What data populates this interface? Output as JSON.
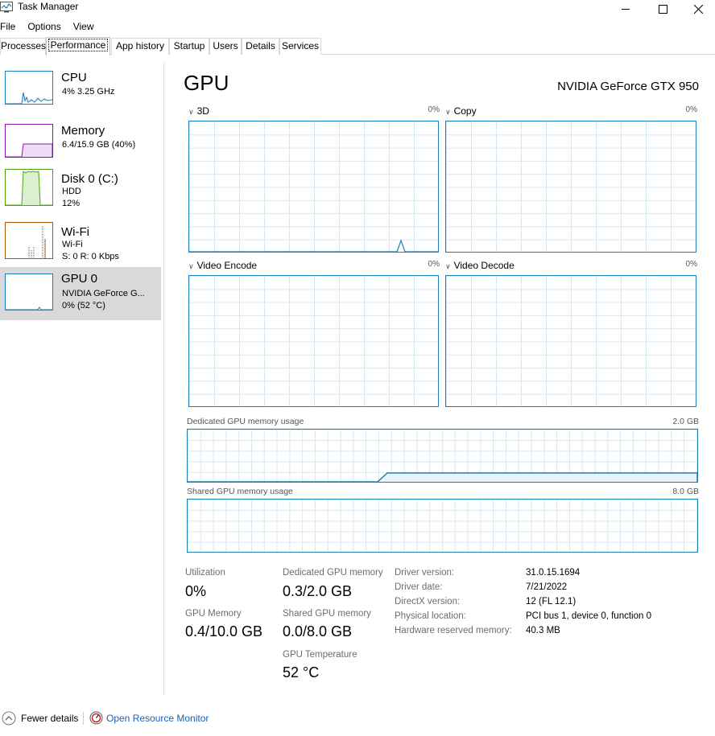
{
  "window": {
    "title": "Task Manager"
  },
  "menu": [
    "File",
    "Options",
    "View"
  ],
  "tabs": [
    "Processes",
    "Performance",
    "App history",
    "Startup",
    "Users",
    "Details",
    "Services"
  ],
  "sidebar": [
    {
      "title": "CPU",
      "line1": "4% 3.25 GHz",
      "line2": "",
      "color": "#1e7eb8"
    },
    {
      "title": "Memory",
      "line1": "6.4/15.9 GB (40%)",
      "line2": "",
      "color": "#8b12ae"
    },
    {
      "title": "Disk 0 (C:)",
      "line1": "HDD",
      "line2": "12%",
      "color": "#4da60c"
    },
    {
      "title": "Wi-Fi",
      "line1": "Wi-Fi",
      "line2": "S: 0 R: 0 Kbps",
      "color": "#a74f01"
    },
    {
      "title": "GPU 0",
      "line1": "NVIDIA GeForce G...",
      "line2": "0% (52 °C)",
      "color": "#1e7eb8"
    }
  ],
  "gpu": {
    "title": "GPU",
    "model": "NVIDIA GeForce GTX 950",
    "engines": [
      {
        "name": "3D",
        "pct": "0%"
      },
      {
        "name": "Copy",
        "pct": "0%"
      },
      {
        "name": "Video Encode",
        "pct": "0%"
      },
      {
        "name": "Video Decode",
        "pct": "0%"
      }
    ],
    "dedicated_label": "Dedicated GPU memory usage",
    "dedicated_max": "2.0 GB",
    "shared_label": "Shared GPU memory usage",
    "shared_max": "8.0 GB",
    "stats": {
      "utilization_label": "Utilization",
      "utilization": "0%",
      "gpu_memory_label": "GPU Memory",
      "gpu_memory": "0.4/10.0 GB",
      "dedicated_label": "Dedicated GPU memory",
      "dedicated": "0.3/2.0 GB",
      "shared_label": "Shared GPU memory",
      "shared": "0.0/8.0 GB",
      "temp_label": "GPU Temperature",
      "temp": "52 °C"
    },
    "info": [
      {
        "key": "Driver version:",
        "value": "31.0.15.1694"
      },
      {
        "key": "Driver date:",
        "value": "7/21/2022"
      },
      {
        "key": "DirectX version:",
        "value": "12 (FL 12.1)"
      },
      {
        "key": "Physical location:",
        "value": "PCI bus 1, device 0, function 0"
      },
      {
        "key": "Hardware reserved memory:",
        "value": "40.3 MB"
      }
    ]
  },
  "footer": {
    "fewer": "Fewer details",
    "orm": "Open Resource Monitor"
  },
  "colors": {
    "graph_line": "#1e7eb8",
    "grid": "#d6e8f2",
    "selected_bg": "#d9d9d9",
    "link": "#1a5fb4"
  }
}
